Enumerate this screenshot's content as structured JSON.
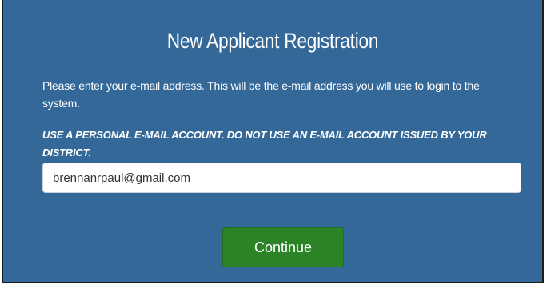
{
  "page": {
    "title": "New Applicant Registration",
    "instructions": "Please enter your e-mail address. This will be the e-mail address you will use to login to the system.",
    "warning": "USE A PERSONAL E-MAIL ACCOUNT. DO NOT USE AN E-MAIL ACCOUNT ISSUED BY YOUR DISTRICT."
  },
  "form": {
    "email_value": "brennanrpaul@gmail.com",
    "continue_label": "Continue"
  },
  "colors": {
    "panel_background": "#346898",
    "button_green": "#2b8227"
  }
}
